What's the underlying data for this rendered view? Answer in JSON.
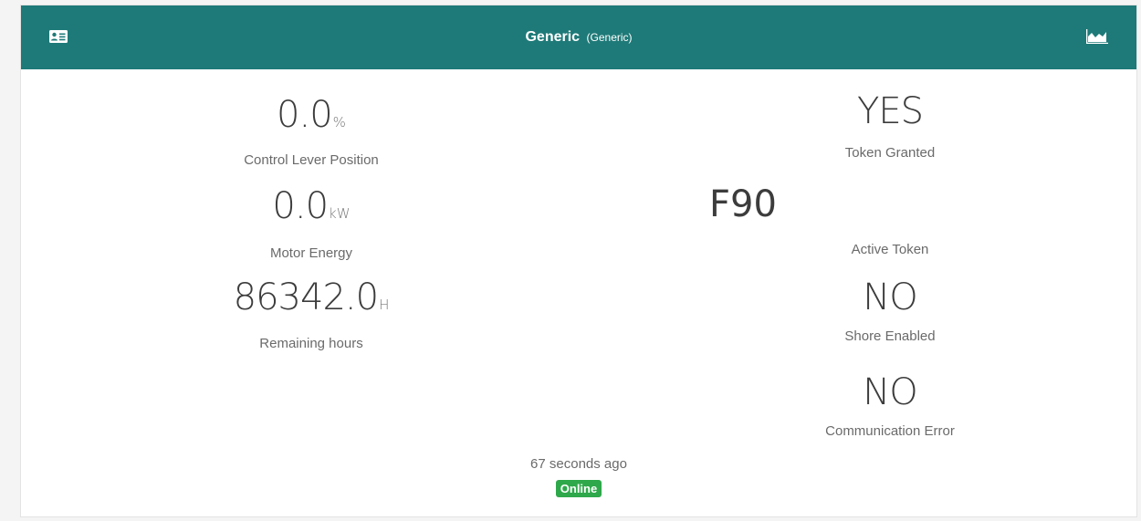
{
  "header": {
    "title": "Generic",
    "subtitle": "(Generic)",
    "left_icon": "id-card-icon",
    "right_icon": "area-chart-icon",
    "background_color": "#1e7a78"
  },
  "metrics_left": [
    {
      "value": "0.0",
      "unit": "%",
      "label": "Control Lever Position"
    },
    {
      "value": "0.0",
      "unit": "kW",
      "label": "Motor Energy"
    },
    {
      "value": "86342.0",
      "unit": "H",
      "label": "Remaining hours"
    }
  ],
  "metrics_right": [
    {
      "value": "YES",
      "label": "Token Granted"
    },
    {
      "value": "F90",
      "label": "Active Token"
    },
    {
      "value": "NO",
      "label": "Shore Enabled"
    },
    {
      "value": "NO",
      "label": "Communication Error"
    }
  ],
  "footer": {
    "last_update": "67 seconds ago",
    "status": "Online",
    "status_color": "#2ea84a"
  }
}
